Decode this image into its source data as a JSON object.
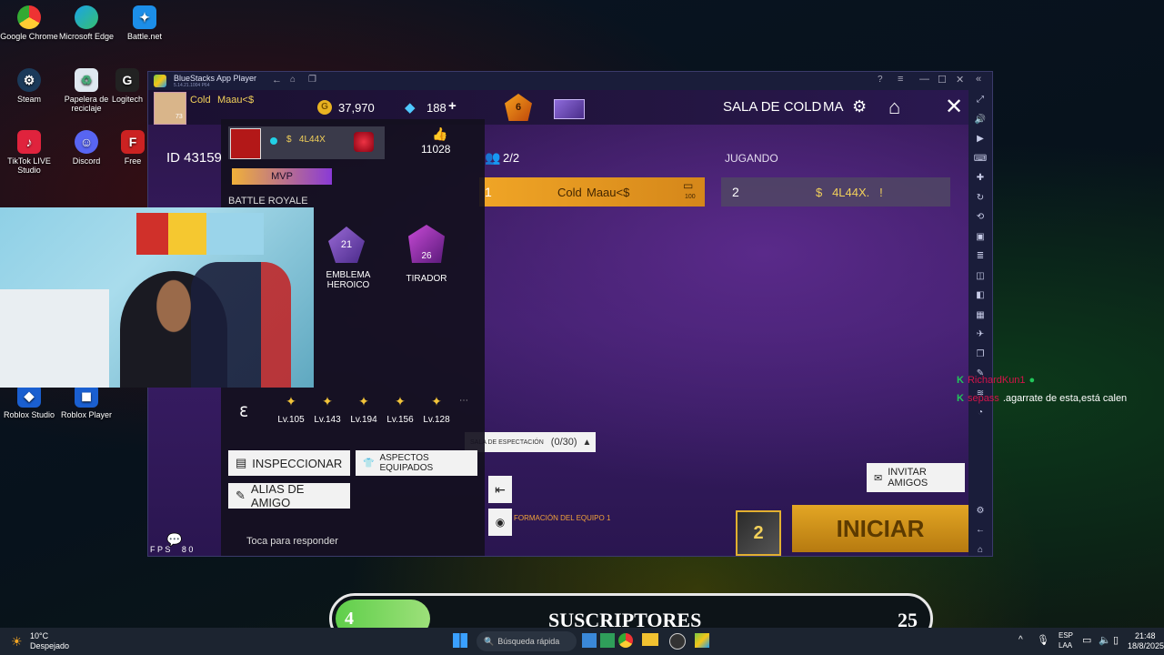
{
  "desktop": {
    "icons": [
      {
        "label": "Google Chrome"
      },
      {
        "label": "Microsoft Edge"
      },
      {
        "label": "Battle.net"
      },
      {
        "label": "Steam"
      },
      {
        "label": "Papelera de reciclaje"
      },
      {
        "label": "Logitech"
      },
      {
        "label": "TikTok LIVE Studio"
      },
      {
        "label": "Discord"
      },
      {
        "label": "Free"
      },
      {
        "label": "Roblox Studio"
      },
      {
        "label": "Roblox Player"
      }
    ]
  },
  "bluestacks": {
    "title": "BlueStacks App Player",
    "version": "5.14.21.1004  P64"
  },
  "game": {
    "player_name_tag": "Cold",
    "player_name": "Maau<$",
    "player_level": "73",
    "gold": "37,970",
    "diamonds": "188",
    "diamonds_plus": "+",
    "rank_badge": "6",
    "room_title": "SALA DE COLD",
    "region": "MA",
    "player_id": "ID 43159",
    "team_count": "2/2",
    "status": "JUGANDO",
    "slot1_number": "1",
    "slot1_tag": "Cold",
    "slot1_name": "Maau<$",
    "slot1_badge": "100",
    "slot2_number": "2",
    "slot2_name": "$   4L44X.   !",
    "spectator_label": "SALA DE ESPECTACIÓN",
    "spectator_count": "(0/30)",
    "team_formation": "FORMACIÓN DEL EQUIPO 1",
    "invite_button": "INVITAR AMIGOS",
    "start_button": "INICIAR",
    "mode_badge": "2",
    "fps": "F P S     8 0",
    "chat_hint": "Toca para responder"
  },
  "profile_card": {
    "friend_name": "$   4L44X",
    "likes": "11028",
    "mvp": "MVP",
    "mode": "BATTLE ROYALE",
    "emblem1_level": "21",
    "emblem1_label": "EMBLEMA HEROICO",
    "emblem2_level": "26",
    "emblem2_label": "TIRADOR",
    "levels": [
      "Lv.105",
      "Lv.143",
      "Lv.194",
      "Lv.156",
      "Lv.128"
    ],
    "inspect_button": "INSPECCIONAR",
    "skins_button": "ASPECTOS EQUIPADOS",
    "alias_button": "ALIAS DE AMIGO"
  },
  "chat_overlay": [
    {
      "user": "RichardKun1",
      "msg": ""
    },
    {
      "user": "sepass",
      "msg": ".agarrate de esta,está calen"
    }
  ],
  "sub_goal": {
    "current": "4",
    "label": "SUSCRIPTORES",
    "goal": "25",
    "progress": 0.16
  },
  "taskbar": {
    "weather_temp": "10°C",
    "weather_desc": "Despejado",
    "search_placeholder": "Búsqueda rápida",
    "lang1": "ESP",
    "lang2": "LAA",
    "time": "21:48",
    "date": "18/8/2025"
  },
  "colors": {
    "accent_gold": "#e9a21d",
    "start_button": "#c88a12",
    "chat_user": "#d4144a",
    "chat_k": "#22c65a"
  }
}
